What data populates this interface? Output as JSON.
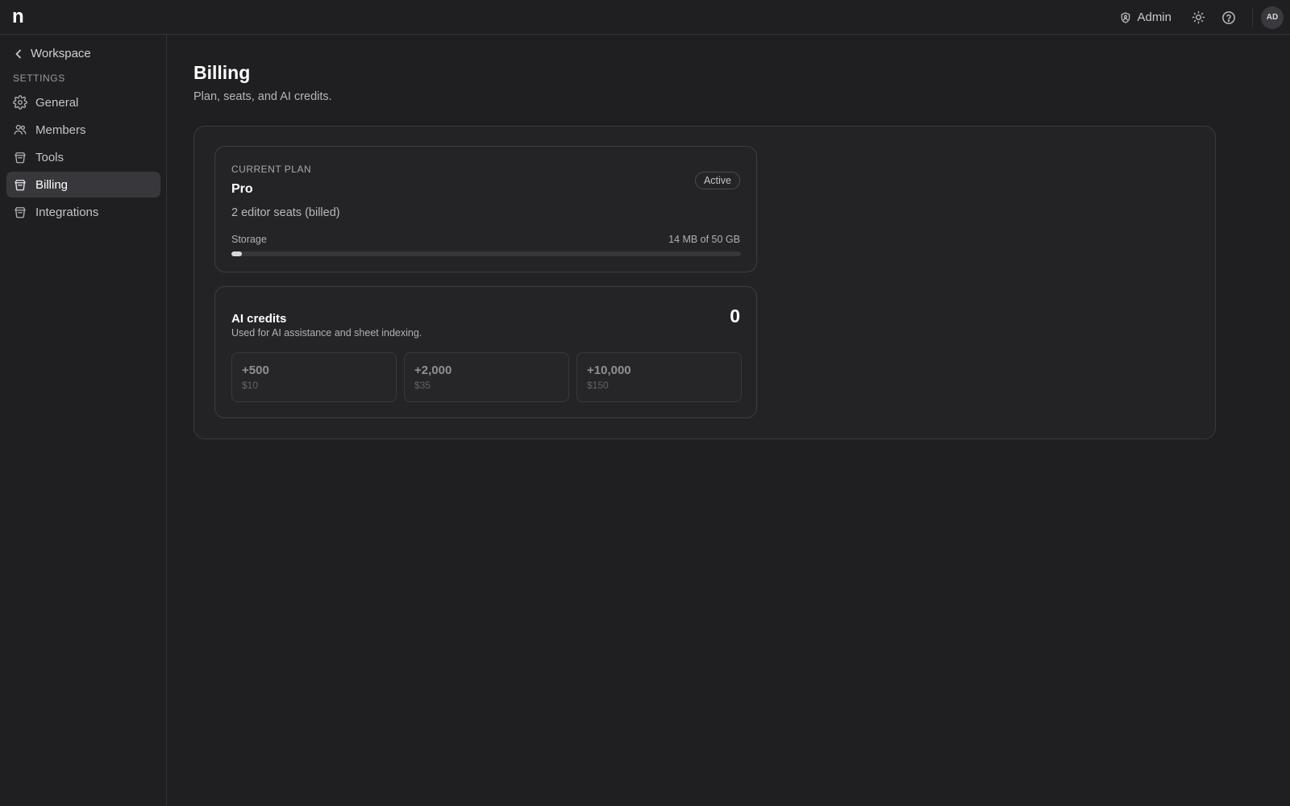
{
  "app": {
    "logo": "n"
  },
  "topbar": {
    "role_label": "Admin",
    "avatar_initials": "AD",
    "icons": [
      "shield-icon",
      "sun-icon",
      "help-icon"
    ]
  },
  "sidebar": {
    "back_label": "Workspace",
    "section_label": "SETTINGS",
    "items": [
      {
        "label": "General",
        "icon": "gear-icon",
        "active": false
      },
      {
        "label": "Members",
        "icon": "users-icon",
        "active": false
      },
      {
        "label": "Tools",
        "icon": "box-icon",
        "active": false
      },
      {
        "label": "Billing",
        "icon": "box-icon",
        "active": true
      },
      {
        "label": "Integrations",
        "icon": "box-icon",
        "active": false
      }
    ]
  },
  "page": {
    "title": "Billing",
    "subtitle": "Plan, seats, and AI credits."
  },
  "plan": {
    "caption": "CURRENT PLAN",
    "name": "Pro",
    "status": "Active",
    "seats": "2 editor seats (billed)",
    "storage_label": "Storage",
    "storage_value": "14 MB of 50 GB",
    "storage_fraction": 0.02
  },
  "credits": {
    "title": "AI credits",
    "description": "Used for AI assistance and sheet indexing.",
    "balance": "0",
    "packs": [
      {
        "amount": "+500",
        "price": "$10"
      },
      {
        "amount": "+2,000",
        "price": "$35"
      },
      {
        "amount": "+10,000",
        "price": "$150"
      }
    ]
  },
  "colors": {
    "background": "#1f1f21",
    "panel": "#232326",
    "active_nav": "#38383c",
    "progress_fill": "#d8d8dc"
  }
}
